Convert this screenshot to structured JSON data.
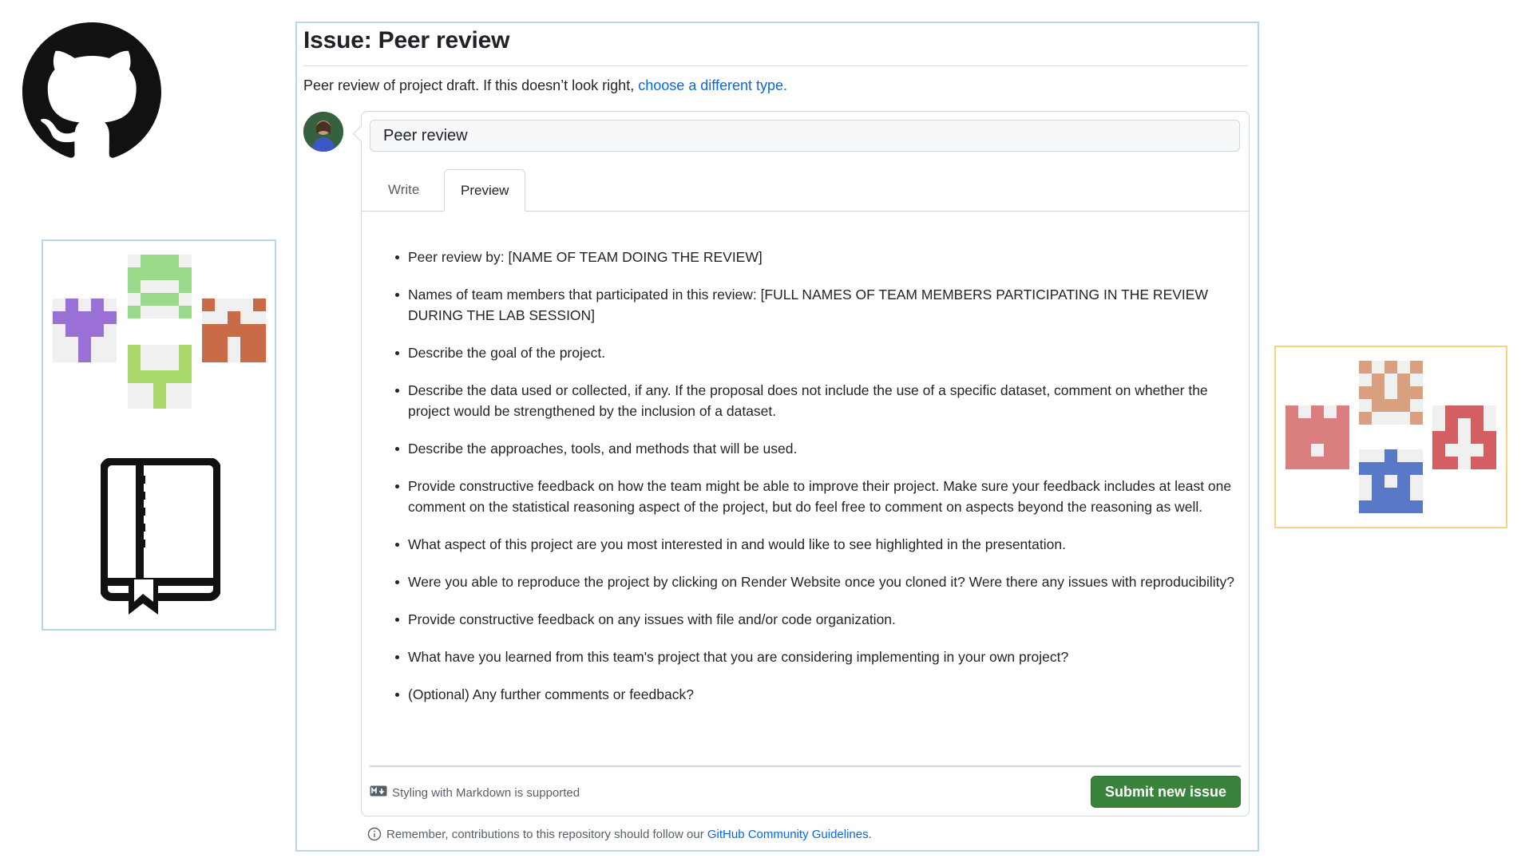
{
  "issue": {
    "heading": "Issue: Peer review",
    "intro_text": "Peer review of project draft. If this doesn’t look right,",
    "intro_link": "choose a different type.",
    "title_value": "Peer review",
    "tabs": [
      {
        "label": "Write",
        "active": false
      },
      {
        "label": "Preview",
        "active": true
      }
    ],
    "preview_items": [
      "Peer review by: [NAME OF TEAM DOING THE REVIEW]",
      "Names of team members that participated in this review: [FULL NAMES OF TEAM MEMBERS PARTICIPATING IN THE REVIEW DURING THE LAB SESSION]",
      "Describe the goal of the project.",
      "Describe the data used or collected, if any. If the proposal does not include the use of a specific dataset, comment on whether the project would be strengthened by the inclusion of a dataset.",
      "Describe the approaches, tools, and methods that will be used.",
      "Provide constructive feedback on how the team might be able to improve their project. Make sure your feedback includes at least one comment on the statistical reasoning aspect of the project, but do feel free to comment on aspects beyond the reasoning as well.",
      "What aspect of this project are you most interested in and would like to see highlighted in the presentation.",
      "Were you able to reproduce the project by clicking on Render Website once you cloned it? Were there any issues with reproducibility?",
      "Provide constructive feedback on any issues with file and/or code organization.",
      "What have you learned from this team's project that you are considering implementing in your own project?",
      "(Optional) Any further comments or feedback?"
    ],
    "markdown_hint": "Styling with Markdown is supported",
    "submit_label": "Submit new issue",
    "guidelines_text": "Remember, contributions to this repository should follow our",
    "guidelines_link": "GitHub Community Guidelines",
    "guidelines_end": "."
  },
  "icons": {
    "logo": "github-octocat-icon",
    "repo": "repo-book-icon",
    "avatar": "user-avatar",
    "markdown": "markdown-icon",
    "info": "info-icon"
  },
  "colors": {
    "link": "#0969da",
    "submit": "#3a833d",
    "left_panel_border": "#b7d7ea",
    "right_panel_border": "#f3d582",
    "identicons_left": [
      "#9a6fd6",
      "#9ad88a",
      "#c96a48",
      "#a8d86a"
    ],
    "identicons_right": [
      "#d97f80",
      "#d9a07f",
      "#d45f63",
      "#5a78c8"
    ]
  }
}
